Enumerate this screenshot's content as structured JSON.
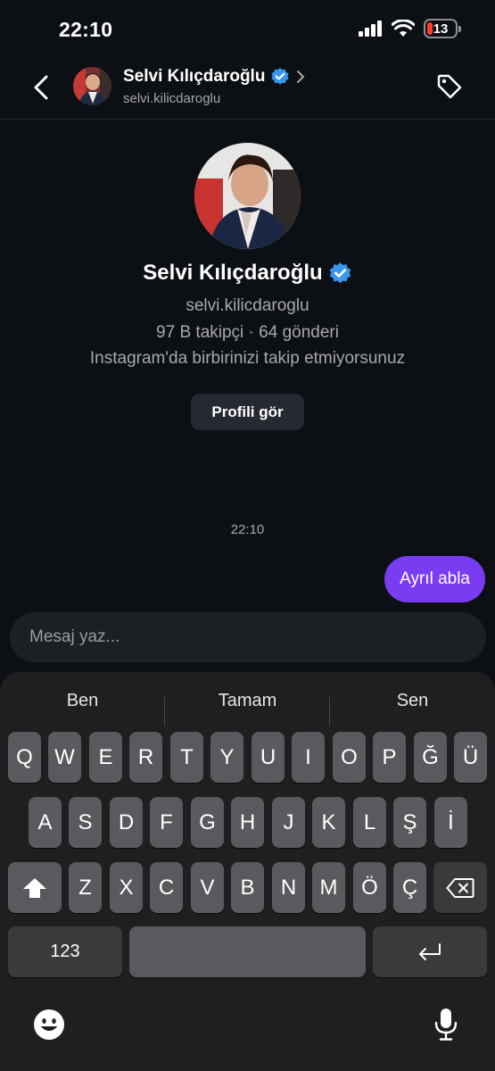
{
  "status": {
    "time": "22:10",
    "battery": "13",
    "battery_color": "#ff3b30"
  },
  "header": {
    "name": "Selvi Kılıçdaroğlu",
    "username": "selvi.kilicdaroglu",
    "back_icon": "chevron-left-icon",
    "tag_icon": "tag-icon",
    "verified_icon": "verified-badge-icon"
  },
  "profile": {
    "name": "Selvi Kılıçdaroğlu",
    "username": "selvi.kilicdaroglu",
    "stats": "97 B takipçi · 64 gönderi",
    "follow_status": "Instagram'da birbirinizi takip etmiyorsunuz",
    "view_button": "Profili gör"
  },
  "messages": {
    "time": "22:10",
    "items": [
      {
        "text": "Ayrıl abla",
        "sender": "me",
        "color": "#7a3cf0"
      }
    ]
  },
  "composer": {
    "placeholder": "Mesaj yaz..."
  },
  "keyboard": {
    "suggestions": [
      "Ben",
      "Tamam",
      "Sen"
    ],
    "row1": [
      "Q",
      "W",
      "E",
      "R",
      "T",
      "Y",
      "U",
      "I",
      "O",
      "P",
      "Ğ",
      "Ü"
    ],
    "row2": [
      "A",
      "S",
      "D",
      "F",
      "G",
      "H",
      "J",
      "K",
      "L",
      "Ş",
      "İ"
    ],
    "row3": [
      "Z",
      "X",
      "C",
      "V",
      "B",
      "N",
      "M",
      "Ö",
      "Ç"
    ],
    "numbers_key": "123",
    "shift_icon": "shift-icon",
    "backspace_icon": "backspace-icon",
    "return_icon": "return-icon",
    "emoji_icon": "emoji-icon",
    "mic_icon": "microphone-icon"
  }
}
